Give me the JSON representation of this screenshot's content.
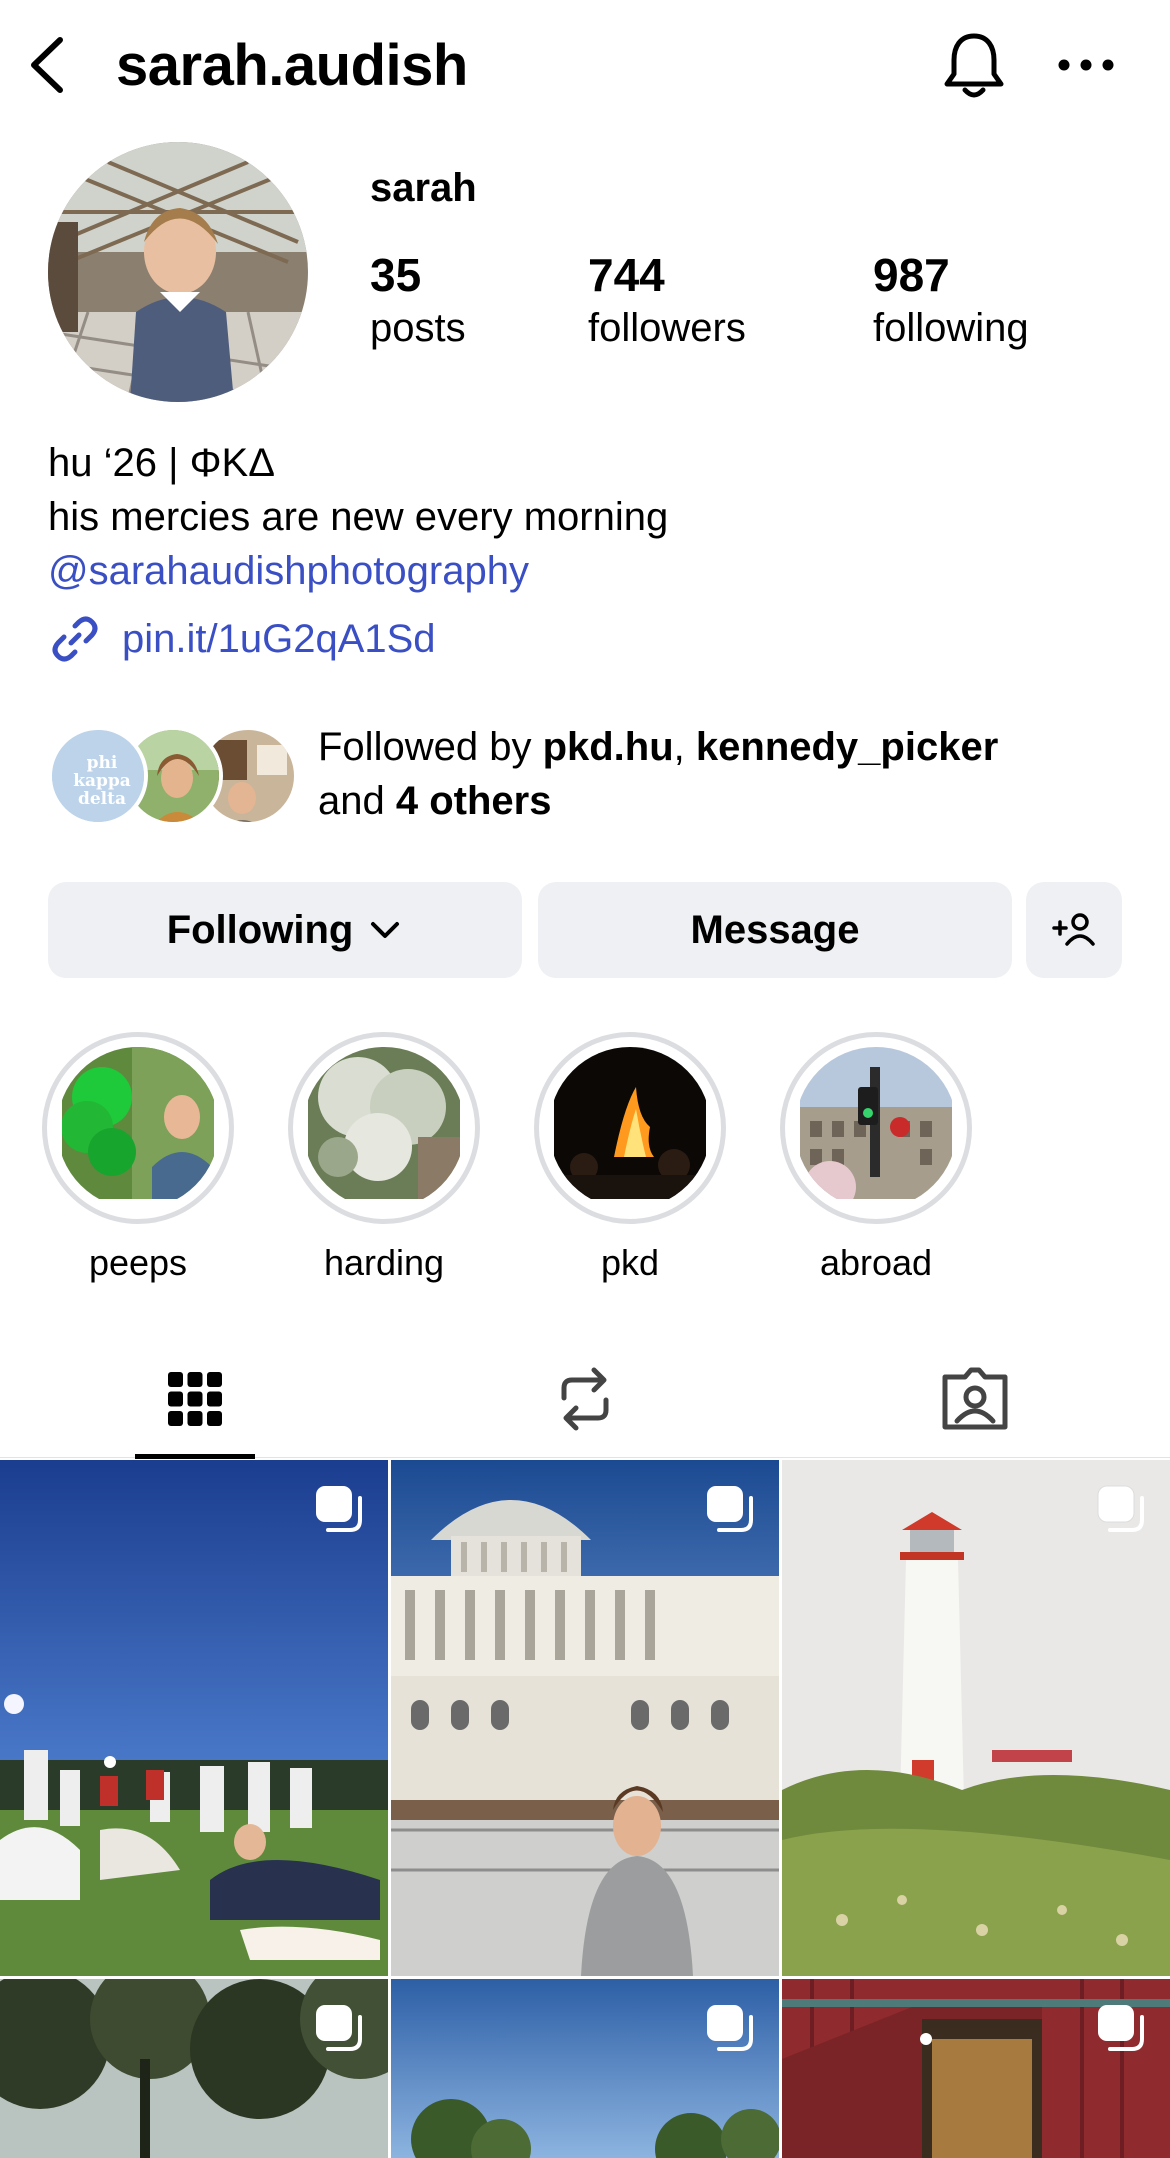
{
  "header": {
    "username": "sarah.audish",
    "back_icon": "chevron-left-icon",
    "bell_icon": "bell-icon",
    "more_icon": "more-horizontal-icon"
  },
  "profile": {
    "display_name": "sarah",
    "stats": [
      {
        "number": "35",
        "label": "posts"
      },
      {
        "number": "744",
        "label": "followers"
      },
      {
        "number": "987",
        "label": "following"
      }
    ]
  },
  "bio": {
    "line1": "hu ‘26 | ΦΚΔ",
    "line2": "his mercies are new every morning",
    "mention": "@sarahaudishphotography",
    "link": "pin.it/1uG2qA1Sd"
  },
  "followed_by": {
    "prefix": "Followed by ",
    "user1": "pkd.hu",
    "separator": ", ",
    "user2": "kennedy_picker",
    "and_text": "and ",
    "others": "4 others",
    "badge_text": "phi kappa delta"
  },
  "buttons": {
    "following": "Following",
    "message": "Message"
  },
  "highlights": [
    {
      "label": "peeps"
    },
    {
      "label": "harding"
    },
    {
      "label": "pkd"
    },
    {
      "label": "abroad"
    }
  ],
  "tabs": [
    {
      "icon": "grid-icon",
      "active": true
    },
    {
      "icon": "reposts-icon",
      "active": false
    },
    {
      "icon": "tagged-icon",
      "active": false
    }
  ],
  "colors": {
    "link_blue": "#3b4fc4",
    "button_bg": "#eef0f3",
    "highlight_ring": "#dcdde0"
  }
}
